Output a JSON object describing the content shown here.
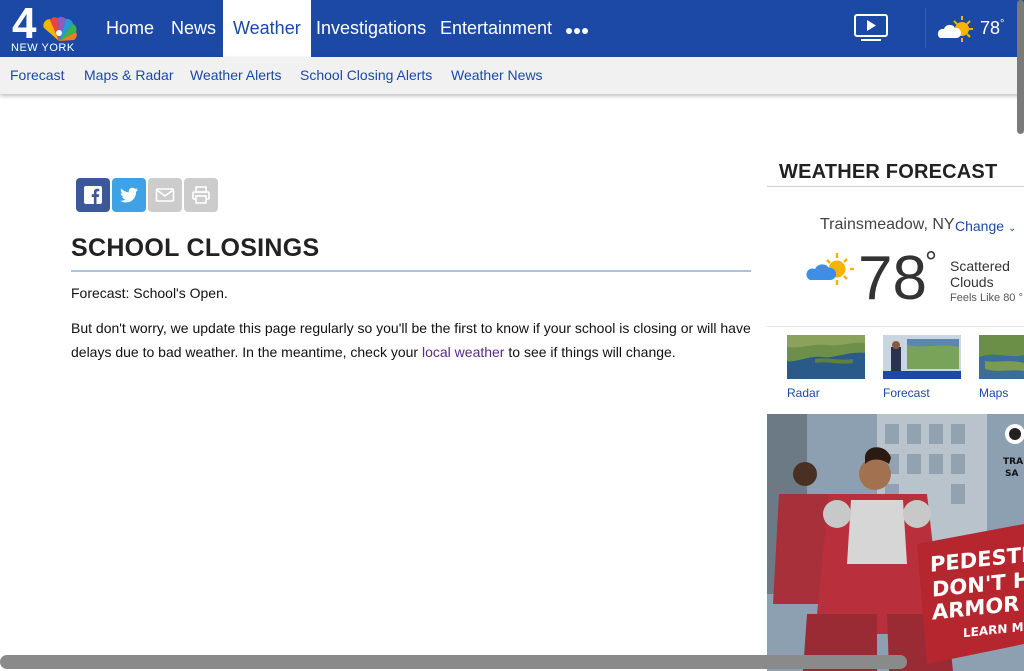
{
  "brand": {
    "logo_number": "4",
    "logo_text": "NEW YORK"
  },
  "nav": {
    "items": [
      {
        "label": "Home"
      },
      {
        "label": "News"
      },
      {
        "label": "Weather",
        "active": true
      },
      {
        "label": "Investigations"
      },
      {
        "label": "Entertainment"
      }
    ],
    "more_icon": "ellipsis-icon",
    "video_icon": "video-play-icon",
    "weather_icon": "partly-cloudy-icon",
    "temperature": "78",
    "degree": "°"
  },
  "subnav": {
    "items": [
      {
        "label": "Forecast"
      },
      {
        "label": "Maps & Radar"
      },
      {
        "label": "Weather Alerts"
      },
      {
        "label": "School Closing Alerts"
      },
      {
        "label": "Weather News"
      }
    ]
  },
  "share": {
    "buttons": [
      {
        "icon": "facebook-icon",
        "color": "#3b5998"
      },
      {
        "icon": "twitter-icon",
        "color": "#3fa1e6"
      },
      {
        "icon": "email-icon",
        "color": "#cccccc"
      },
      {
        "icon": "print-icon",
        "color": "#cccccc"
      }
    ]
  },
  "article": {
    "title": "SCHOOL CLOSINGS",
    "forecast_line": "Forecast: School's Open.",
    "body_before_link": "But don't worry, we update this page regularly so you'll be the first to know if your school is closing or will have delays due to bad weather. In the meantime, check your ",
    "link_text": "local weather",
    "body_after_link": " to see if things will change."
  },
  "sidebar": {
    "title": "WEATHER FORECAST",
    "location": "Trainsmeadow, NY",
    "change_label": "Change",
    "temperature": "78",
    "degree": "°",
    "condition_line1": "Scattered",
    "condition_line2": "Clouds",
    "feels_like": "Feels Like 80 °",
    "thumbnails": [
      {
        "label": "Radar"
      },
      {
        "label": "Forecast"
      },
      {
        "label": "Maps"
      }
    ]
  },
  "ad": {
    "brand_letter": "O",
    "brand_line1": "TRA",
    "brand_line2": "SA",
    "headline1": "PEDESTRIA",
    "headline2": "DON'T HAV",
    "headline3": "ARMOR",
    "cta": "LEARN MOR"
  },
  "colors": {
    "brand_blue": "#1b49a5",
    "link_purple": "#5b2a86",
    "rule_blue": "#a9c1e4"
  }
}
